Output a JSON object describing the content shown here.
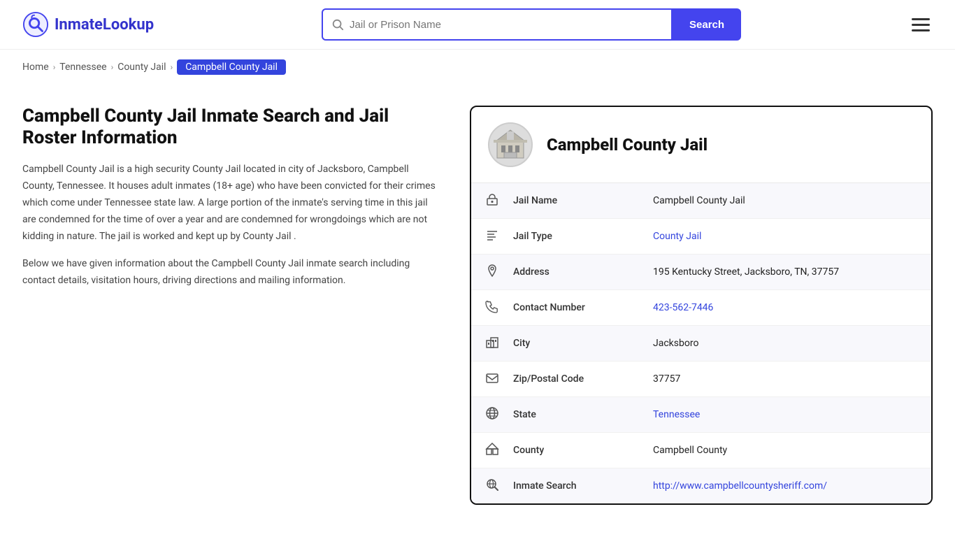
{
  "header": {
    "logo_text_part1": "Inmate",
    "logo_text_part2": "Lookup",
    "search_placeholder": "Jail or Prison Name",
    "search_button_label": "Search"
  },
  "breadcrumb": {
    "home": "Home",
    "state": "Tennessee",
    "jail_type": "County Jail",
    "current": "Campbell County Jail"
  },
  "main": {
    "page_title": "Campbell County Jail Inmate Search and Jail Roster Information",
    "description_1": "Campbell County Jail is a high security County Jail located in city of Jacksboro, Campbell County, Tennessee. It houses adult inmates (18+ age) who have been convicted for their crimes which come under Tennessee state law. A large portion of the inmate's serving time in this jail are condemned for the time of over a year and are condemned for wrongdoings which are not kidding in nature. The jail is worked and kept up by County Jail .",
    "description_2": "Below we have given information about the Campbell County Jail inmate search including contact details, visitation hours, driving directions and mailing information."
  },
  "info_card": {
    "title": "Campbell County Jail",
    "rows": [
      {
        "icon": "jail-icon",
        "label": "Jail Name",
        "value": "Campbell County Jail",
        "link": false
      },
      {
        "icon": "list-icon",
        "label": "Jail Type",
        "value": "County Jail",
        "link": true,
        "href": "#"
      },
      {
        "icon": "pin-icon",
        "label": "Address",
        "value": "195 Kentucky Street, Jacksboro, TN, 37757",
        "link": false
      },
      {
        "icon": "phone-icon",
        "label": "Contact Number",
        "value": "423-562-7446",
        "link": true,
        "href": "tel:4235627446"
      },
      {
        "icon": "city-icon",
        "label": "City",
        "value": "Jacksboro",
        "link": false
      },
      {
        "icon": "mail-icon",
        "label": "Zip/Postal Code",
        "value": "37757",
        "link": false
      },
      {
        "icon": "globe-icon",
        "label": "State",
        "value": "Tennessee",
        "link": true,
        "href": "#"
      },
      {
        "icon": "county-icon",
        "label": "County",
        "value": "Campbell County",
        "link": false
      },
      {
        "icon": "search-globe-icon",
        "label": "Inmate Search",
        "value": "http://www.campbellcountysheriff.com/",
        "link": true,
        "href": "http://www.campbellcountysheriff.com/"
      }
    ]
  }
}
